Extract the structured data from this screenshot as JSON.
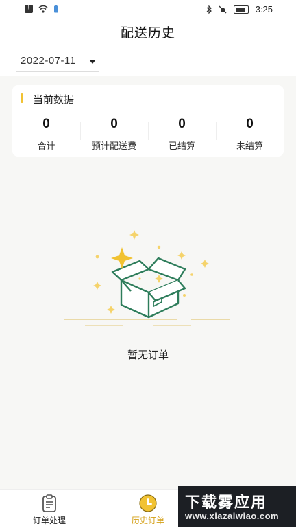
{
  "statusbar": {
    "time": "3:25"
  },
  "header": {
    "title": "配送历史"
  },
  "date_filter": {
    "value": "2022-07-11"
  },
  "summary": {
    "title": "当前数据",
    "stats": [
      {
        "value": "0",
        "label": "合计"
      },
      {
        "value": "0",
        "label": "预计配送费"
      },
      {
        "value": "0",
        "label": "已结算"
      },
      {
        "value": "0",
        "label": "未结算"
      }
    ]
  },
  "empty_state": {
    "message": "暂无订单",
    "icon": "empty-box-icon"
  },
  "tabbar": {
    "items": [
      {
        "label": "订单处理",
        "icon": "clipboard-icon",
        "active": false
      },
      {
        "label": "历史订单",
        "icon": "history-clock-icon",
        "active": true
      }
    ]
  },
  "watermark": {
    "line1": "下载雾应用",
    "line2": "www.xiazaiwiao.com"
  },
  "colors": {
    "accent": "#f1c232",
    "active_tab": "#d4a017",
    "box_green": "#2e7d5b"
  }
}
